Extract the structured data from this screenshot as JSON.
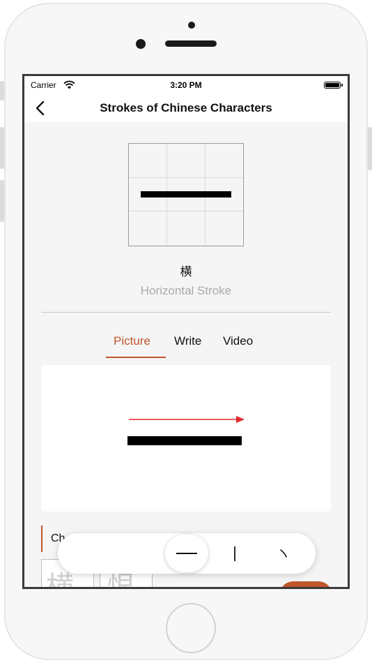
{
  "status_bar": {
    "carrier": "Carrier",
    "time": "3:20 PM"
  },
  "nav": {
    "title": "Strokes of Chinese Characters"
  },
  "stroke": {
    "character": "横",
    "name": "Horizontal Stroke"
  },
  "tabs": [
    {
      "label": "Picture",
      "active": true
    },
    {
      "label": "Write",
      "active": false
    },
    {
      "label": "Video",
      "active": false
    }
  ],
  "section": {
    "label_partial": "Ch"
  },
  "stroke_picker": {
    "items": [
      {
        "glyph": "—",
        "selected": true
      },
      {
        "glyph": "|",
        "selected": false
      },
      {
        "glyph": "、",
        "selected": false
      }
    ]
  },
  "colors": {
    "accent": "#c0552b",
    "arrow": "#e0282e",
    "stroke": "#000000"
  }
}
